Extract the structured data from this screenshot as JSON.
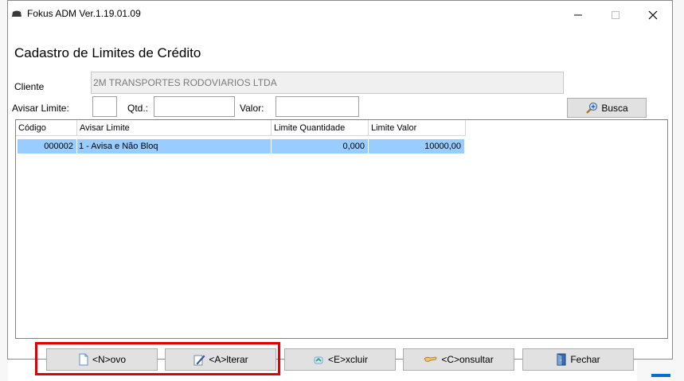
{
  "window": {
    "title": "Fokus ADM Ver.1.19.01.09"
  },
  "page": {
    "heading": "Cadastro de Limites de Crédito"
  },
  "form": {
    "cliente_label": "Cliente",
    "cliente_value": "2M TRANSPORTES RODOVIARIOS LTDA",
    "avisar_label": "Avisar Limite:",
    "qtd_label": "Qtd.:",
    "valor_label": "Valor:",
    "busca_label": "Busca"
  },
  "table": {
    "columns": [
      "Código",
      "Avisar Limite",
      "Limite Quantidade",
      "Limite Valor"
    ],
    "rows": [
      {
        "codigo": "000002",
        "avisar": "1 - Avisa e Não Bloq",
        "quantidade": "0,000",
        "valor": "10000,00"
      }
    ]
  },
  "footer": {
    "novo": "<N>ovo",
    "alterar": "<A>lterar",
    "excluir": "<E>xcluir",
    "consultar": "<C>onsultar",
    "fechar": "Fechar"
  },
  "colors": {
    "selection": "#99ccff",
    "highlight": "#e00000",
    "button": "#e1e1e1"
  }
}
